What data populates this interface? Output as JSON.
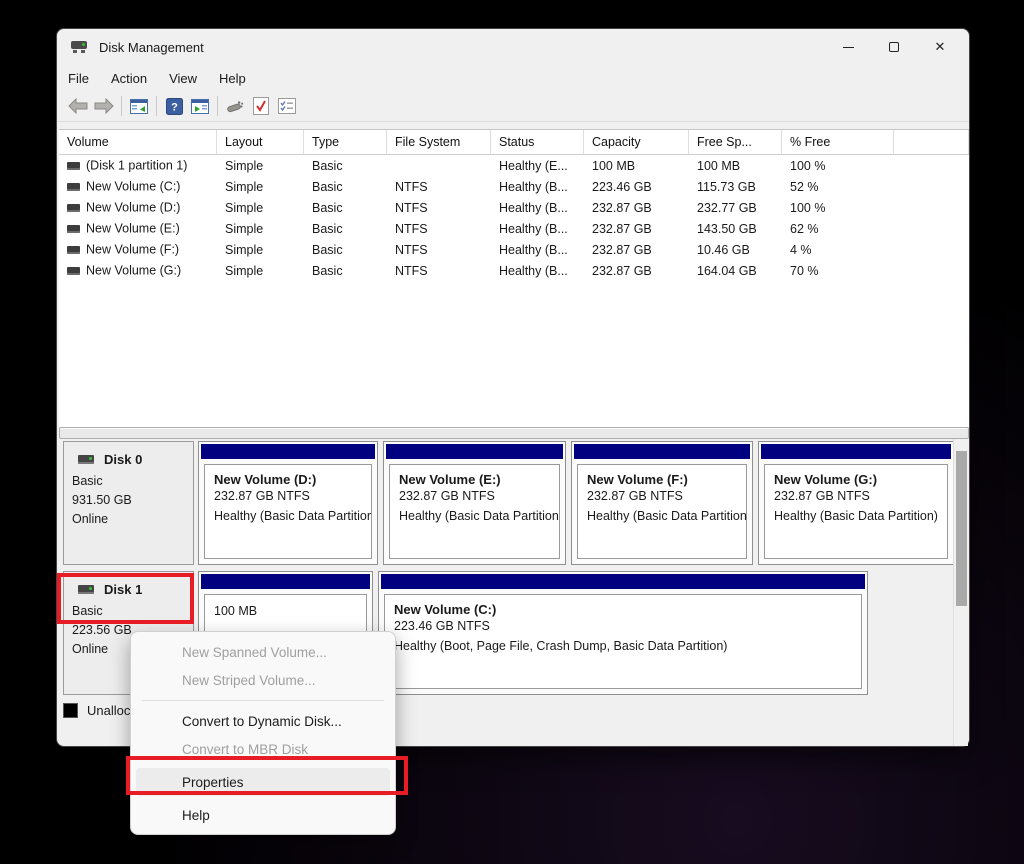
{
  "window": {
    "title": "Disk Management",
    "controls": {
      "close_glyph": "✕"
    }
  },
  "menubar": {
    "items": [
      "File",
      "Action",
      "View",
      "Help"
    ]
  },
  "toolbar": {
    "icons": [
      "back-arrow",
      "forward-arrow",
      "show-console-tree",
      "help",
      "show-action-pane",
      "rescan-disks",
      "check-document",
      "property-list"
    ],
    "help_glyph": "?"
  },
  "volume_table": {
    "columns": [
      "Volume",
      "Layout",
      "Type",
      "File System",
      "Status",
      "Capacity",
      "Free Sp...",
      "% Free"
    ],
    "rows": [
      [
        "(Disk 1 partition 1)",
        "Simple",
        "Basic",
        "",
        "Healthy (E...",
        "100 MB",
        "100 MB",
        "100 %"
      ],
      [
        "New Volume (C:)",
        "Simple",
        "Basic",
        "NTFS",
        "Healthy (B...",
        "223.46 GB",
        "115.73 GB",
        "52 %"
      ],
      [
        "New Volume (D:)",
        "Simple",
        "Basic",
        "NTFS",
        "Healthy (B...",
        "232.87 GB",
        "232.77 GB",
        "100 %"
      ],
      [
        "New Volume (E:)",
        "Simple",
        "Basic",
        "NTFS",
        "Healthy (B...",
        "232.87 GB",
        "143.50 GB",
        "62 %"
      ],
      [
        "New Volume (F:)",
        "Simple",
        "Basic",
        "NTFS",
        "Healthy (B...",
        "232.87 GB",
        "10.46 GB",
        "4 %"
      ],
      [
        "New Volume (G:)",
        "Simple",
        "Basic",
        "NTFS",
        "Healthy (B...",
        "232.87 GB",
        "164.04 GB",
        "70 %"
      ]
    ]
  },
  "graphical_view": {
    "disks": [
      {
        "name": "Disk 0",
        "type": "Basic",
        "size": "931.50 GB",
        "status": "Online",
        "volumes": [
          {
            "title": "New Volume  (D:)",
            "size": "232.87 GB NTFS",
            "status": "Healthy (Basic Data Partition)"
          },
          {
            "title": "New Volume  (E:)",
            "size": "232.87 GB NTFS",
            "status": "Healthy (Basic Data Partition)"
          },
          {
            "title": "New Volume  (F:)",
            "size": "232.87 GB NTFS",
            "status": "Healthy (Basic Data Partition)"
          },
          {
            "title": "New Volume  (G:)",
            "size": "232.87 GB NTFS",
            "status": "Healthy (Basic Data Partition)"
          }
        ]
      },
      {
        "name": "Disk 1",
        "type": "Basic",
        "size": "223.56 GB",
        "status": "Online",
        "volumes": [
          {
            "title": "",
            "size": "100 MB",
            "status": ""
          },
          {
            "title": "New Volume  (C:)",
            "size": "223.46 GB NTFS",
            "status": "Healthy (Boot, Page File, Crash Dump, Basic Data Partition)"
          }
        ]
      }
    ]
  },
  "legend": {
    "unallocated": "Unallocated"
  },
  "context_menu": {
    "items": [
      {
        "label": "New Spanned Volume...",
        "enabled": false
      },
      {
        "label": "New Striped Volume...",
        "enabled": false
      },
      {
        "label": "Convert to Dynamic Disk...",
        "enabled": true
      },
      {
        "label": "Convert to MBR Disk",
        "enabled": false
      },
      {
        "label": "Properties",
        "enabled": true
      },
      {
        "label": "Help",
        "enabled": true
      }
    ]
  },
  "colors": {
    "volume_strip": "#000080",
    "annotation_red": "#e81c24",
    "unallocated_black": "#000000"
  }
}
